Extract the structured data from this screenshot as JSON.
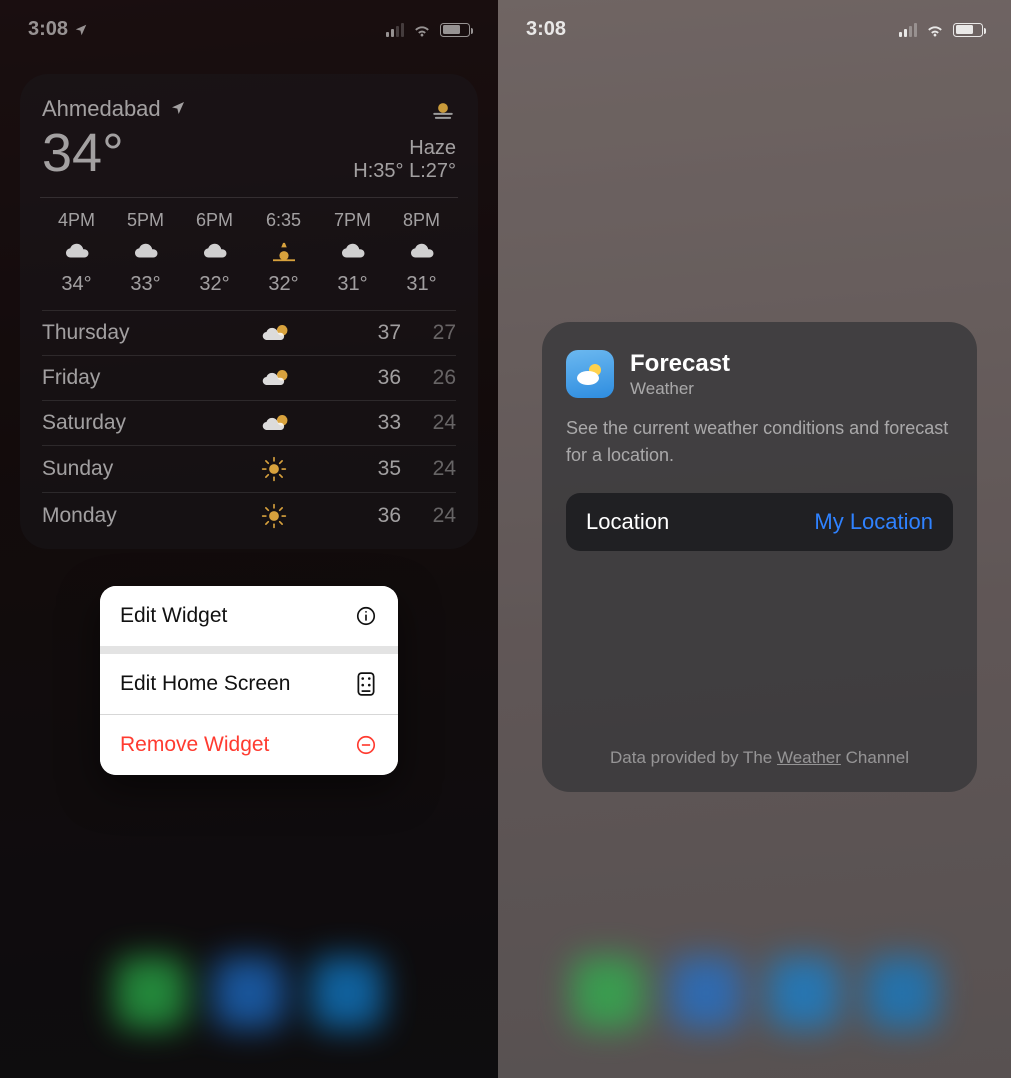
{
  "left": {
    "status": {
      "time": "3:08"
    },
    "widget": {
      "city": "Ahmedabad",
      "temp": "34°",
      "condition": "Haze",
      "hilo": "H:35° L:27°",
      "hours": [
        {
          "time": "4PM",
          "icon": "cloud",
          "temp": "34°"
        },
        {
          "time": "5PM",
          "icon": "cloud",
          "temp": "33°"
        },
        {
          "time": "6PM",
          "icon": "cloud",
          "temp": "32°"
        },
        {
          "time": "6:35",
          "icon": "sunset",
          "temp": "32°"
        },
        {
          "time": "7PM",
          "icon": "cloud",
          "temp": "31°"
        },
        {
          "time": "8PM",
          "icon": "cloud",
          "temp": "31°"
        }
      ],
      "days": [
        {
          "name": "Thursday",
          "icon": "partly",
          "hi": "37",
          "lo": "27"
        },
        {
          "name": "Friday",
          "icon": "partly",
          "hi": "36",
          "lo": "26"
        },
        {
          "name": "Saturday",
          "icon": "partly",
          "hi": "33",
          "lo": "24"
        },
        {
          "name": "Sunday",
          "icon": "sun",
          "hi": "35",
          "lo": "24"
        },
        {
          "name": "Monday",
          "icon": "sun",
          "hi": "36",
          "lo": "24"
        }
      ]
    },
    "menu": {
      "edit_widget": "Edit Widget",
      "edit_home": "Edit Home Screen",
      "remove": "Remove Widget"
    }
  },
  "right": {
    "status": {
      "time": "3:08"
    },
    "sheet": {
      "title": "Forecast",
      "app": "Weather",
      "desc": "See the current weather conditions and forecast for a location.",
      "row_label": "Location",
      "row_value": "My Location",
      "footer_prefix": "Data provided by The ",
      "footer_link": "Weather",
      "footer_suffix": " Channel"
    }
  }
}
